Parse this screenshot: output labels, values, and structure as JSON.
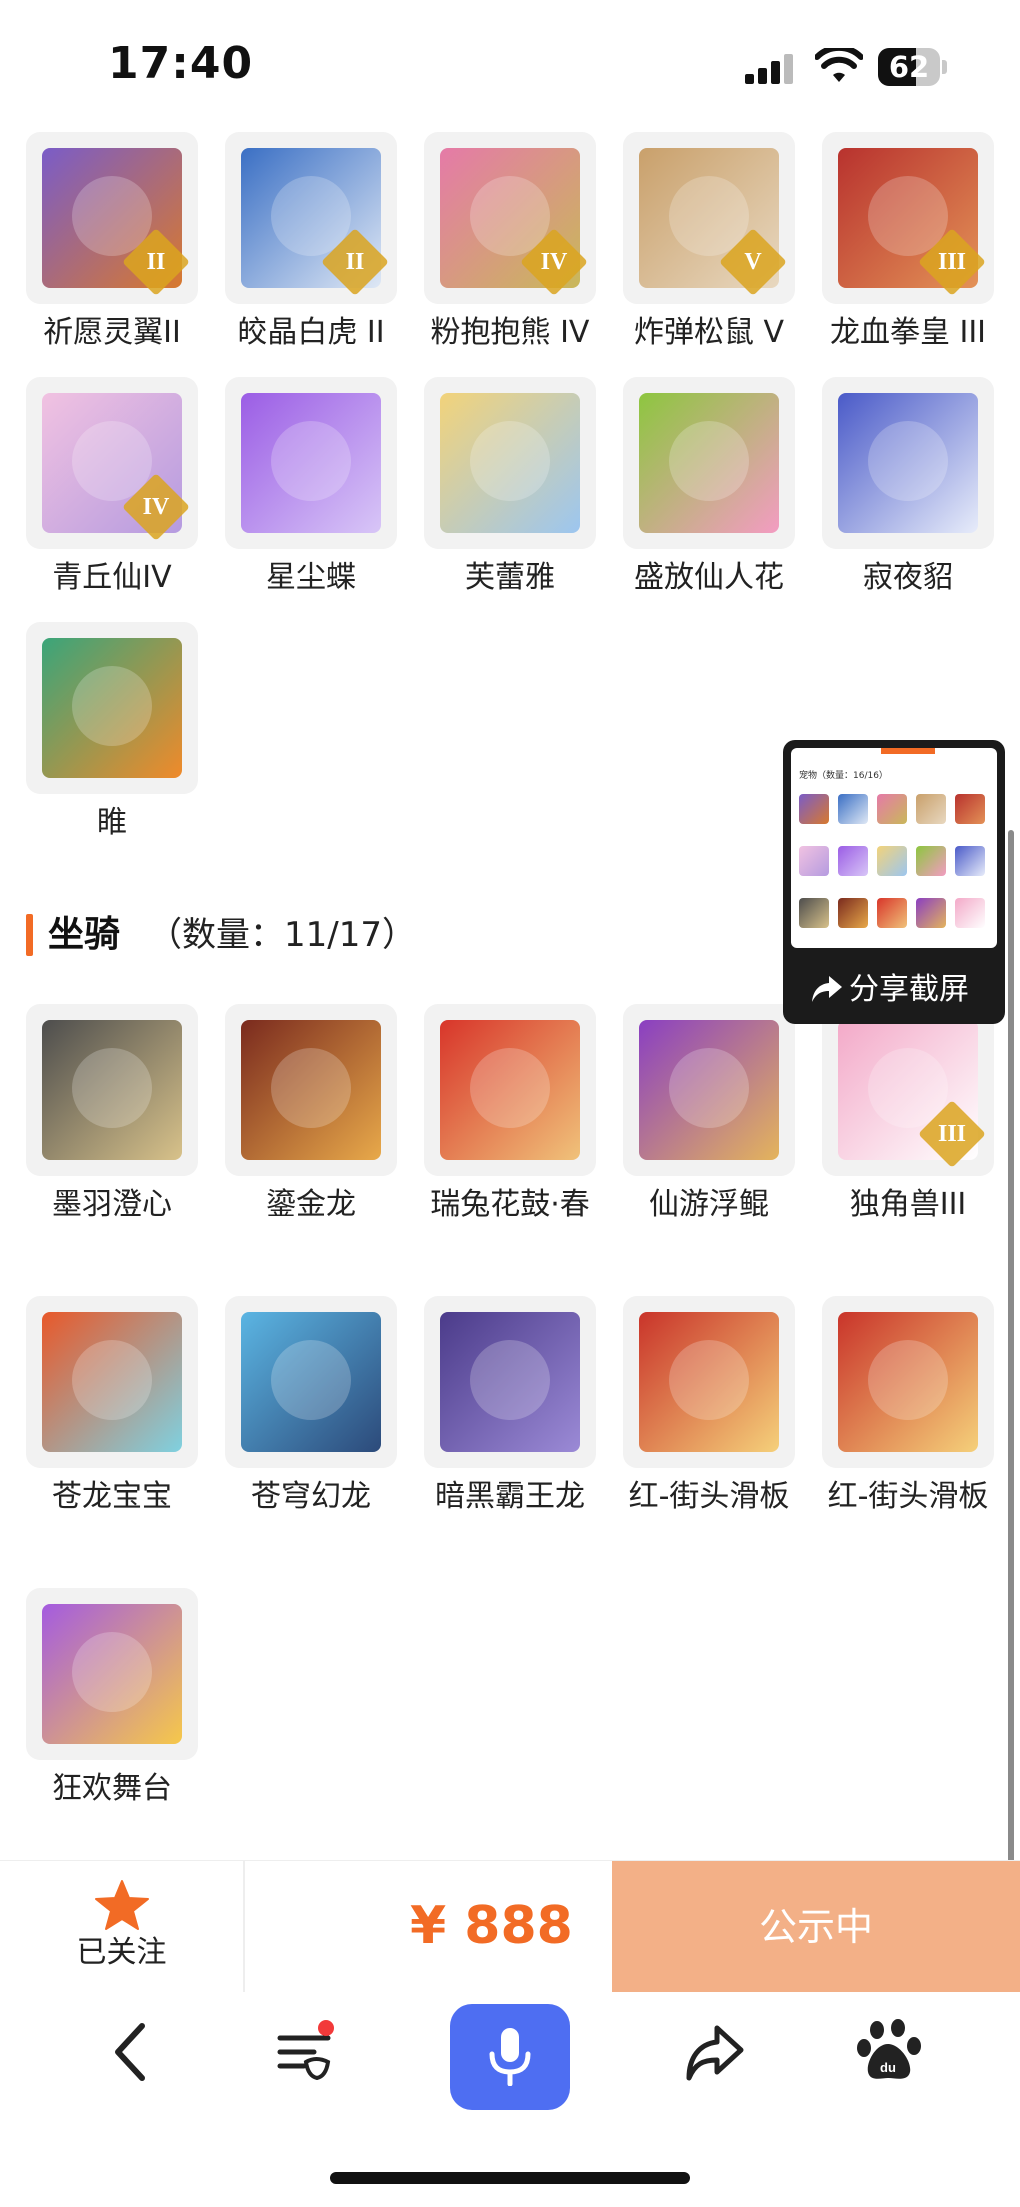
{
  "status_bar": {
    "time": "17:40",
    "battery": "62",
    "battery_level": 0.62
  },
  "pets": [
    {
      "name": "祈愿灵翼II",
      "tier": "II",
      "colors": [
        "#7a5cc8",
        "#d8792e"
      ]
    },
    {
      "name": "皎晶白虎 II",
      "tier": "II",
      "colors": [
        "#3a6fc4",
        "#dfe8f5"
      ]
    },
    {
      "name": "粉抱抱熊 IV",
      "tier": "IV",
      "colors": [
        "#e57aa8",
        "#c9b85a"
      ]
    },
    {
      "name": "炸弹松鼠 V",
      "tier": "V",
      "colors": [
        "#c9a06b",
        "#e8d8c0"
      ]
    },
    {
      "name": "龙血拳皇 III",
      "tier": "III",
      "colors": [
        "#b8322e",
        "#e39257"
      ]
    },
    {
      "name": "青丘仙IV",
      "tier": "IV",
      "colors": [
        "#f1c2e1",
        "#b59be0"
      ]
    },
    {
      "name": "星尘蝶",
      "tier": "",
      "colors": [
        "#9b5de5",
        "#d8c6f7"
      ]
    },
    {
      "name": "芙蕾雅",
      "tier": "",
      "colors": [
        "#f2d37a",
        "#9cc6f0"
      ]
    },
    {
      "name": "盛放仙人花",
      "tier": "",
      "colors": [
        "#8dc63f",
        "#f39cc2"
      ]
    },
    {
      "name": "寂夜貂",
      "tier": "",
      "colors": [
        "#4a5ac8",
        "#e7ecfa"
      ]
    },
    {
      "name": "睢",
      "tier": "",
      "colors": [
        "#3aa57a",
        "#f08a2a"
      ]
    }
  ],
  "mounts_section": {
    "title": "坐骑",
    "count": "（数量：11/17）"
  },
  "mounts": [
    {
      "name": "墨羽澄心",
      "tier": "",
      "colors": [
        "#4d4d4d",
        "#d8c28a"
      ]
    },
    {
      "name": "鎏金龙",
      "tier": "",
      "colors": [
        "#7a2a1e",
        "#e8a94a"
      ]
    },
    {
      "name": "瑞兔花鼓·春",
      "tier": "",
      "colors": [
        "#d8352a",
        "#f0c27a"
      ]
    },
    {
      "name": "仙游浮鲲",
      "tier": "",
      "colors": [
        "#8a3fc2",
        "#e4b45c"
      ]
    },
    {
      "name": "独角兽III",
      "tier": "III",
      "colors": [
        "#f3a9c8",
        "#ffffff"
      ]
    },
    {
      "name": "苍龙宝宝",
      "tier": "",
      "colors": [
        "#e8582a",
        "#7fd1e0"
      ]
    },
    {
      "name": "苍穹幻龙",
      "tier": "",
      "colors": [
        "#5bb5e3",
        "#2c4a7a"
      ]
    },
    {
      "name": "暗黑霸王龙",
      "tier": "",
      "colors": [
        "#4b3b8a",
        "#9b8ad6"
      ]
    },
    {
      "name": "红-街头滑板",
      "tier": "",
      "colors": [
        "#c9342a",
        "#f5d07a"
      ]
    },
    {
      "name": "红-街头滑板",
      "tier": "",
      "colors": [
        "#c9342a",
        "#f5d07a"
      ]
    },
    {
      "name": "狂欢舞台",
      "tier": "",
      "colors": [
        "#a45be0",
        "#f6c84a"
      ]
    }
  ],
  "screenshot_popup": {
    "preview_header": "宠物（数量：16/16）",
    "share_label": "分享截屏"
  },
  "action_bar": {
    "follow_label": "已关注",
    "price": "¥ 888",
    "status_label": "公示中"
  },
  "colors": {
    "accent": "#f26b25",
    "status_button": "#f3b087",
    "voice_button": "#4e6ef2"
  },
  "nav_icons": [
    "back-icon",
    "menu-mask-icon",
    "microphone-icon",
    "share-icon",
    "baidu-paw-icon"
  ]
}
